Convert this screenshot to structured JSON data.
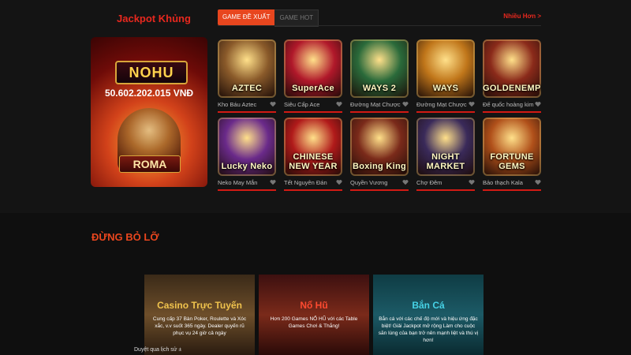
{
  "header": {
    "jackpot_title": "Jackpot Khủng",
    "tabs": [
      {
        "label": "GAME ĐỀ XUẤT",
        "active": true
      },
      {
        "label": "GAME HOT",
        "active": false
      }
    ],
    "more_link": "Nhiều Hơn >"
  },
  "jackpot": {
    "logo": "NOHU",
    "amount": "50.602.202.015 VNĐ",
    "game_badge": "ROMA"
  },
  "games": [
    {
      "label": "Kho Báu Aztec",
      "thumb_text": "AZTEC",
      "color": "#8a5a2a"
    },
    {
      "label": "Siêu Cấp Ace",
      "thumb_text": "SuperAce",
      "color": "#b0182a"
    },
    {
      "label": "Đường Mạt Chược",
      "thumb_text": "WAYS 2",
      "color": "#2a6a3a"
    },
    {
      "label": "Đường Mạt Chược",
      "thumb_text": "WAYS",
      "color": "#c0761a"
    },
    {
      "label": "Đế quốc hoàng kim",
      "thumb_text": "GOLDENEMPIRE",
      "color": "#8a2a1a"
    },
    {
      "label": "Neko May Mắn",
      "thumb_text": "Lucky Neko",
      "color": "#6a2a8a"
    },
    {
      "label": "Tết Nguyên Đán",
      "thumb_text": "CHINESE NEW YEAR",
      "color": "#b01a1a"
    },
    {
      "label": "Quyền Vương",
      "thumb_text": "Boxing King",
      "color": "#7a2a1a"
    },
    {
      "label": "Chợ Đêm",
      "thumb_text": "NIGHT MARKET",
      "color": "#3a2a5a"
    },
    {
      "label": "Bảo thạch Kala",
      "thumb_text": "FORTUNE GEMS",
      "color": "#b0501a"
    }
  ],
  "section": {
    "title": "ĐỪNG BỎ LỠ"
  },
  "promos": [
    {
      "title": "Casino Trực Tuyến",
      "desc": "Cung cấp 37 Bàn Poker, Roulette và Xóc xắc, v.v suốt 365 ngày. Dealer quyến rũ phục vụ 24 giờ cả ngày"
    },
    {
      "title": "Nổ Hũ",
      "desc": "Hơn 200 Games NỔ HŨ với các Table Games Chơi & Thắng!"
    },
    {
      "title": "Bắn Cá",
      "desc": "Bắn cá với các chế độ mới và hiệu ứng đặc biệt! Giải Jackpot mở rộng Làm cho cuộc săn lùng của bạn trở nên mạnh liệt và thú vị hơn!"
    }
  ],
  "footer": {
    "link": "Duyệt qua lịch sử ±"
  },
  "colors": {
    "accent": "#e8461e",
    "title_red": "#e8281e",
    "underline": "#d21a14"
  },
  "icons": {
    "favorite": "heart-icon"
  }
}
